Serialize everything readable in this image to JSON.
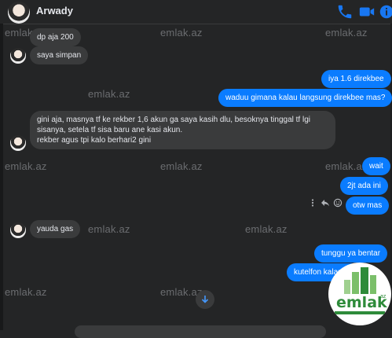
{
  "header": {
    "name": "Arwady"
  },
  "watermark": "emlak.az",
  "messages": {
    "m1": "dp aja 200",
    "m2": "saya simpan",
    "m3": "iya 1.6 direkbee",
    "m4": "waduu gimana kalau langsung direkbee mas?",
    "m5_line1": "gini aja, masnya tf ke rekber 1,6 akun ga saya kasih dlu, besoknya tinggal tf lgi",
    "m5_line2": "sisanya, setela tf sisa baru ane kasi akun.",
    "m5_line3": "rekber agus tpi kalo berhari2 gini",
    "m6": "wait",
    "m7": "2jt ada ini",
    "m8": "otw mas",
    "m9": "yauda gas",
    "m10": "tunggu ya bentar",
    "m11": "kutelfon kalau ... uk"
  },
  "logo": {
    "text": "emlak",
    "suffix": ".az"
  },
  "colors": {
    "background": "#242526",
    "incoming_bubble": "#3a3b3c",
    "outgoing_bubble": "#0a7cff",
    "accent": "#0a7cff"
  }
}
